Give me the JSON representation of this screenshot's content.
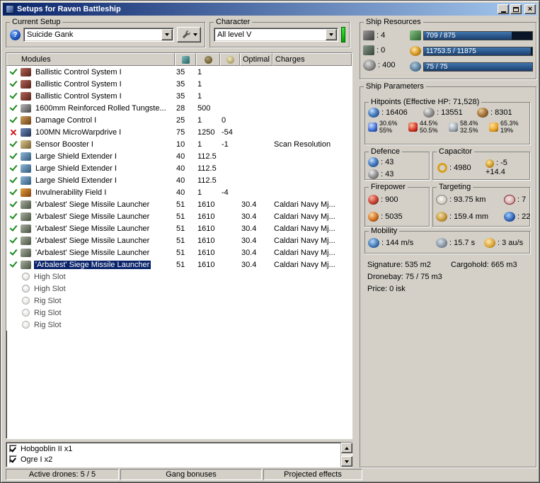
{
  "window": {
    "title": "Setups for Raven Battleship"
  },
  "current_setup": {
    "label": "Current Setup",
    "help_icon": "?",
    "value": "Suicide Gank"
  },
  "character": {
    "label": "Character",
    "value": "All level V"
  },
  "modules": {
    "headers": {
      "name": "Modules",
      "optimal": "Optimal",
      "charges": "Charges"
    },
    "rows": [
      {
        "status": "ok",
        "icon": "bcs",
        "name": "Ballistic Control System I",
        "cpu": "35",
        "pg": "1",
        "cap": "",
        "optimal": "",
        "charges": ""
      },
      {
        "status": "ok",
        "icon": "bcs",
        "name": "Ballistic Control System I",
        "cpu": "35",
        "pg": "1",
        "cap": "",
        "optimal": "",
        "charges": ""
      },
      {
        "status": "ok",
        "icon": "bcs",
        "name": "Ballistic Control System I",
        "cpu": "35",
        "pg": "1",
        "cap": "",
        "optimal": "",
        "charges": ""
      },
      {
        "status": "ok",
        "icon": "plate",
        "name": "1600mm Reinforced Rolled Tungste...",
        "cpu": "28",
        "pg": "500",
        "cap": "",
        "optimal": "",
        "charges": ""
      },
      {
        "status": "ok",
        "icon": "dcu",
        "name": "Damage Control I",
        "cpu": "25",
        "pg": "1",
        "cap": "0",
        "optimal": "",
        "charges": ""
      },
      {
        "status": "fail",
        "icon": "mwd",
        "name": "100MN MicroWarpdrive I",
        "cpu": "75",
        "pg": "1250",
        "cap": "-54",
        "optimal": "",
        "charges": ""
      },
      {
        "status": "ok",
        "icon": "sensor",
        "name": "Sensor Booster I",
        "cpu": "10",
        "pg": "1",
        "cap": "-1",
        "optimal": "",
        "charges": "Scan Resolution"
      },
      {
        "status": "ok",
        "icon": "shield",
        "name": "Large Shield Extender I",
        "cpu": "40",
        "pg": "112.5",
        "cap": "",
        "optimal": "",
        "charges": ""
      },
      {
        "status": "ok",
        "icon": "shield",
        "name": "Large Shield Extender I",
        "cpu": "40",
        "pg": "112.5",
        "cap": "",
        "optimal": "",
        "charges": ""
      },
      {
        "status": "ok",
        "icon": "shield",
        "name": "Large Shield Extender I",
        "cpu": "40",
        "pg": "112.5",
        "cap": "",
        "optimal": "",
        "charges": ""
      },
      {
        "status": "ok",
        "icon": "invuln",
        "name": "Invulnerability Field I",
        "cpu": "40",
        "pg": "1",
        "cap": "-4",
        "optimal": "",
        "charges": ""
      },
      {
        "status": "ok",
        "icon": "launcher",
        "name": "'Arbalest' Siege Missile Launcher",
        "cpu": "51",
        "pg": "1610",
        "cap": "",
        "optimal": "30.4",
        "charges": "Caldari Navy Mj..."
      },
      {
        "status": "ok",
        "icon": "launcher",
        "name": "'Arbalest' Siege Missile Launcher",
        "cpu": "51",
        "pg": "1610",
        "cap": "",
        "optimal": "30.4",
        "charges": "Caldari Navy Mj..."
      },
      {
        "status": "ok",
        "icon": "launcher",
        "name": "'Arbalest' Siege Missile Launcher",
        "cpu": "51",
        "pg": "1610",
        "cap": "",
        "optimal": "30.4",
        "charges": "Caldari Navy Mj..."
      },
      {
        "status": "ok",
        "icon": "launcher",
        "name": "'Arbalest' Siege Missile Launcher",
        "cpu": "51",
        "pg": "1610",
        "cap": "",
        "optimal": "30.4",
        "charges": "Caldari Navy Mj..."
      },
      {
        "status": "ok",
        "icon": "launcher",
        "name": "'Arbalest' Siege Missile Launcher",
        "cpu": "51",
        "pg": "1610",
        "cap": "",
        "optimal": "30.4",
        "charges": "Caldari Navy Mj..."
      },
      {
        "status": "ok",
        "icon": "launcher",
        "name": "'Arbalest' Siege Missile Launcher",
        "cpu": "51",
        "pg": "1610",
        "cap": "",
        "optimal": "30.4",
        "charges": "Caldari Navy Mj...",
        "sel": "sel"
      },
      {
        "status": "",
        "icon": "highslot",
        "name": "High Slot",
        "cpu": "",
        "pg": "",
        "cap": "",
        "optimal": "",
        "charges": "",
        "kind": "slot"
      },
      {
        "status": "",
        "icon": "highslot",
        "name": "High Slot",
        "cpu": "",
        "pg": "",
        "cap": "",
        "optimal": "",
        "charges": "",
        "kind": "slot"
      },
      {
        "status": "",
        "icon": "rigslot",
        "name": "Rig Slot",
        "cpu": "",
        "pg": "",
        "cap": "",
        "optimal": "",
        "charges": "",
        "kind": "slot"
      },
      {
        "status": "",
        "icon": "rigslot",
        "name": "Rig Slot",
        "cpu": "",
        "pg": "",
        "cap": "",
        "optimal": "",
        "charges": "",
        "kind": "slot"
      },
      {
        "status": "",
        "icon": "rigslot",
        "name": "Rig Slot",
        "cpu": "",
        "pg": "",
        "cap": "",
        "optimal": "",
        "charges": "",
        "kind": "slot"
      }
    ]
  },
  "drones": {
    "items": [
      {
        "state": "checked",
        "label": "Hobgoblin II x1"
      },
      {
        "state": "checked",
        "label": "Ogre I x2"
      }
    ]
  },
  "status_bar": {
    "active_drones": "Active drones: 5 / 5",
    "gang_bonuses": "Gang bonuses",
    "projected_effects": "Projected effects"
  },
  "ship_resources": {
    "label": "Ship Resources",
    "turrets": ": 4",
    "launchers": ": 0",
    "calibration": ": 400",
    "cpu": {
      "text": "709 / 875",
      "pct": 81
    },
    "powergrid": {
      "text": "11753.5 / 11875",
      "pct": 99
    },
    "upgrade": {
      "text": "75 / 75",
      "pct": 100
    }
  },
  "ship_parameters": {
    "label": "Ship Parameters",
    "hitpoints": {
      "label": "Hitpoints (Effective HP: 71,528)",
      "shield": ": 16406",
      "armor": ": 13551",
      "structure": ": 8301",
      "resists": [
        {
          "type": "em",
          "shield": "30.6%",
          "armor": "55%"
        },
        {
          "type": "thermal",
          "shield": "44.5%",
          "armor": "50.5%"
        },
        {
          "type": "kinetic",
          "shield": "58.4%",
          "armor": "32.5%"
        },
        {
          "type": "explosive",
          "shield": "65.3%",
          "armor": "19%"
        }
      ]
    },
    "defence": {
      "label": "Defence",
      "shield_value": ": 43",
      "armor_value": ": 43"
    },
    "capacitor": {
      "label": "Capacitor",
      "amount": ": 4980",
      "drain": ": -5",
      "recharge": "+14.4"
    },
    "firepower": {
      "label": "Firepower",
      "dps": ": 900",
      "volley": ": 5035"
    },
    "targeting": {
      "label": "Targeting",
      "range": ": 93.75 km",
      "max_targets": ": 7",
      "scan_resolution": ": 159.4 mm",
      "sensor_strength": ": 22"
    },
    "mobility": {
      "label": "Mobility",
      "speed": ": 144 m/s",
      "align_time": ": 15.7 s",
      "warp_speed": ": 3 au/s"
    },
    "signature": "Signature: 535 m2",
    "cargohold": "Cargohold: 665 m3",
    "dronebay": "Dronebay: 75 / 75 m3",
    "price": "Price: 0 isk"
  }
}
